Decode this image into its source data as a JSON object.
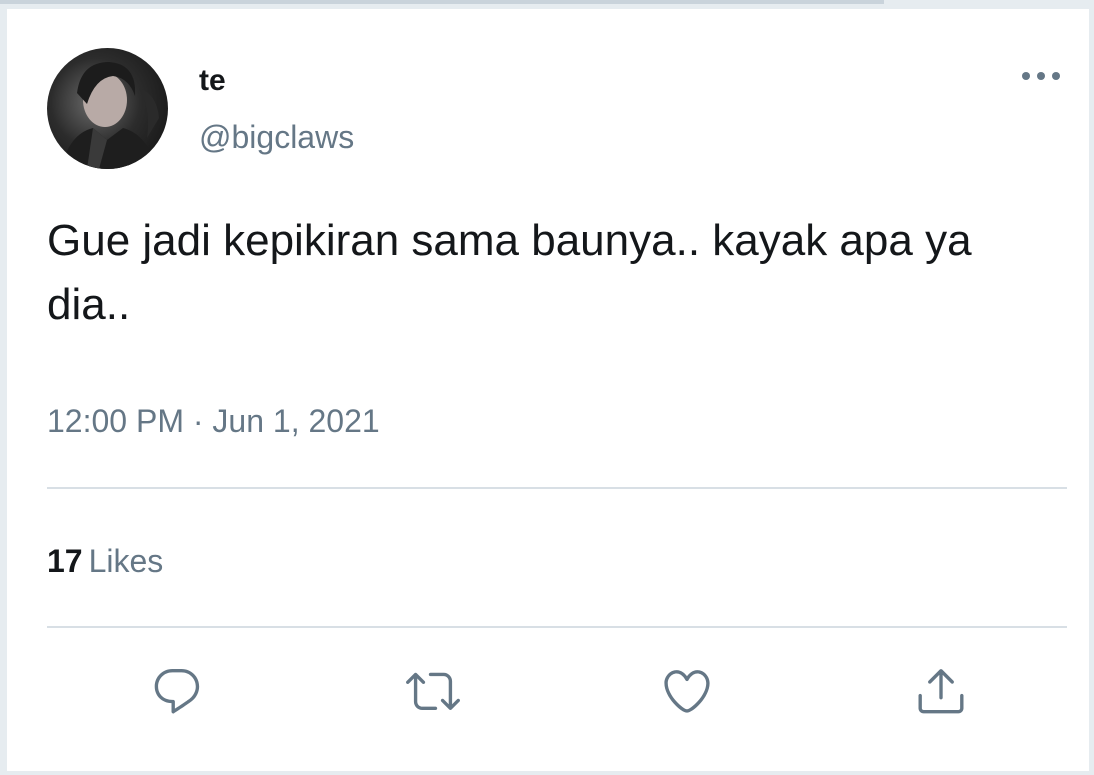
{
  "tweet": {
    "author": {
      "display_name": "te",
      "handle": "@bigclaws",
      "avatar_icon": "profile-photo"
    },
    "text": "Gue jadi kepikiran sama baunya.. kayak apa ya dia..",
    "timestamp": "12:00 PM · Jun 1, 2021",
    "likes": {
      "count": "17",
      "label": "Likes"
    }
  },
  "actions": [
    {
      "name": "reply",
      "icon": "comment-icon"
    },
    {
      "name": "retweet",
      "icon": "retweet-icon"
    },
    {
      "name": "like",
      "icon": "heart-icon"
    },
    {
      "name": "share",
      "icon": "share-icon"
    }
  ],
  "colors": {
    "text_primary": "#14171a",
    "text_secondary": "#657786",
    "icon": "#657786",
    "divider": "#d8dfe5",
    "background": "#e6ecf0"
  }
}
